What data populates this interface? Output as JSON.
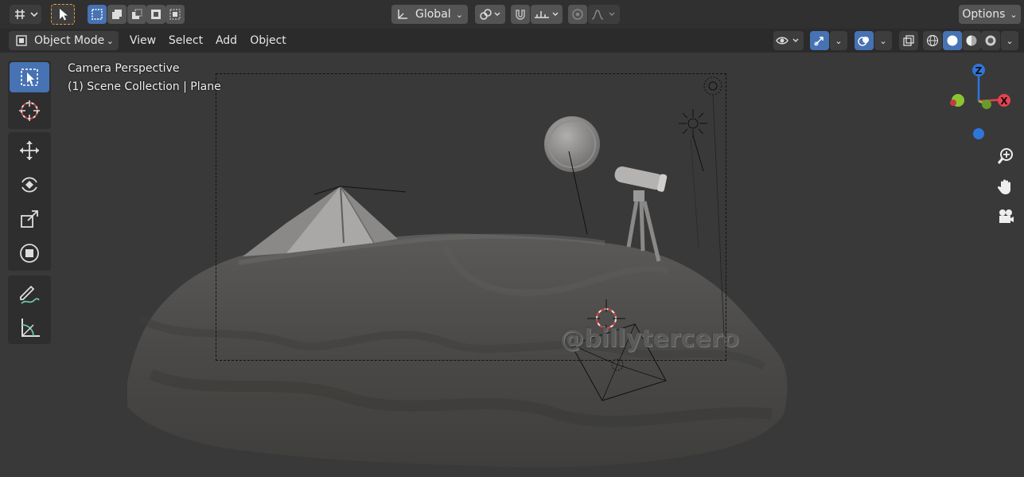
{
  "topbar": {
    "transform_orientation": "Global",
    "options_label": "Options"
  },
  "header": {
    "mode_label": "Object Mode",
    "menus": [
      "View",
      "Select",
      "Add",
      "Object"
    ]
  },
  "viewport": {
    "overlay_line1": "Camera Perspective",
    "overlay_line2": "(1) Scene Collection | Plane",
    "watermark": "@billytercero",
    "gizmo": {
      "z_label": "Z",
      "x_label": "X"
    }
  },
  "colors": {
    "accent": "#4772b3",
    "axis_x": "#e8414f",
    "axis_y": "#8bc431",
    "axis_z": "#2e76d9"
  }
}
